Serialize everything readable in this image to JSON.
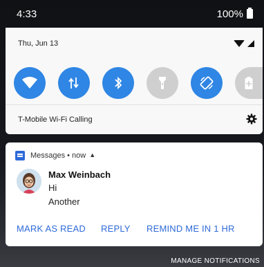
{
  "status_bar": {
    "time": "4:33",
    "battery": "100%"
  },
  "quick_settings": {
    "date": "Thu, Jun 13",
    "carrier_status": "T-Mobile Wi-Fi Calling",
    "accent_color": "#2f86e4",
    "tiles": [
      {
        "icon": "wifi-icon",
        "state": "on"
      },
      {
        "icon": "data-icon",
        "state": "on"
      },
      {
        "icon": "bluetooth-icon",
        "state": "on"
      },
      {
        "icon": "flashlight-icon",
        "state": "off"
      },
      {
        "icon": "auto-rotate-icon",
        "state": "on"
      },
      {
        "icon": "battery-saver-icon",
        "state": "off"
      }
    ]
  },
  "notification": {
    "app_name": "Messages",
    "separator": "•",
    "time": "now",
    "sender": "Max Weinbach",
    "messages": [
      "Hi",
      "Another"
    ],
    "actions": {
      "mark_read": "MARK AS READ",
      "reply": "REPLY",
      "remind": "REMIND ME IN 1 HR"
    },
    "action_color": "#2d6ad8"
  },
  "footer": {
    "manage": "MANAGE NOTIFICATIONS"
  }
}
